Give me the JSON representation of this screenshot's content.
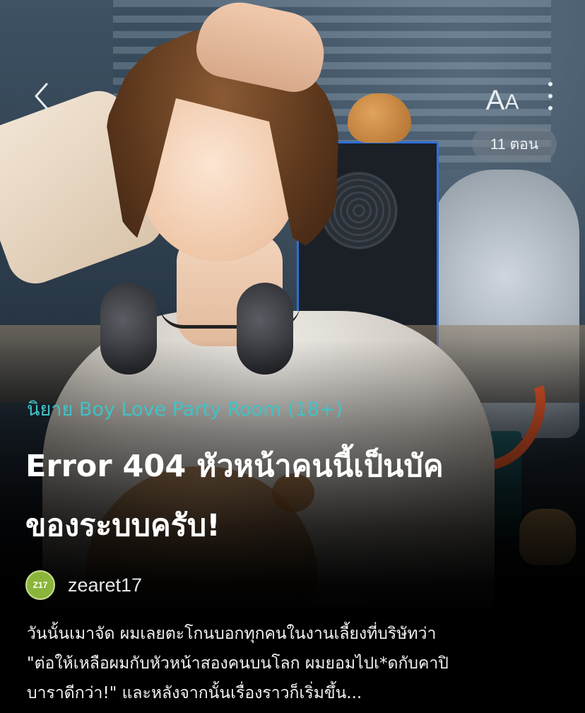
{
  "top_bar": {
    "back_icon": "chevron-left-icon",
    "font_size_label_big": "A",
    "font_size_label_small": "A",
    "more_icon": "more-vertical-icon",
    "episode_count": "11 ตอน"
  },
  "story": {
    "category": "นิยาย Boy Love Party Room (18+)",
    "title_line1": "Error 404 หัวหน้าคนนี้เป็นบัค",
    "title_line2": "ของระบบครับ!",
    "author": {
      "avatar_text": "Z17",
      "name": "zearet17"
    },
    "synopsis_lines": [
      "วันนั้นเมาจัด ผมเลยตะโกนบอกทุกคนในงานเลี้ยงที่บริษัทว่า",
      "\"ต่อให้เหลือผมกับหัวหน้าสองคนบนโลก ผมยอมไปเ*ดกับคาปิ",
      "บาราดีกว่า!\" และหลังจากนั้นเรื่องราวก็เริ่มขึ้น..."
    ]
  },
  "colors": {
    "category_accent": "#3fc3c5",
    "avatar_bg": "#8bb53a",
    "badge_bg": "rgba(120,128,136,0.55)"
  }
}
